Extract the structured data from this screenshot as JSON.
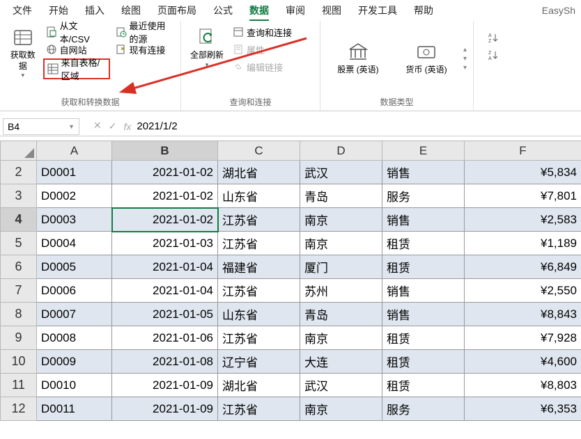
{
  "menu": {
    "items": [
      "文件",
      "开始",
      "插入",
      "绘图",
      "页面布局",
      "公式",
      "数据",
      "审阅",
      "视图",
      "开发工具",
      "帮助"
    ],
    "active_index": 6,
    "right": "EasySh"
  },
  "ribbon": {
    "group1": {
      "label": "获取和转换数据",
      "get_data": "获取数\n据",
      "from_csv": "从文本/CSV",
      "from_web": "自网站",
      "from_table": "来自表格/区域",
      "recent": "最近使用的源",
      "existing": "现有连接"
    },
    "group2": {
      "label": "查询和连接",
      "refresh_all": "全部刷新",
      "queries": "查询和连接",
      "properties": "属性",
      "edit_links": "编辑链接"
    },
    "group3": {
      "label": "数据类型",
      "stocks": "股票 (英语)",
      "currency": "货币 (英语)"
    }
  },
  "formula_bar": {
    "name_box": "B4",
    "formula": "2021/1/2"
  },
  "columns": [
    "A",
    "B",
    "C",
    "D",
    "E",
    "F"
  ],
  "active_row_index": 2,
  "active_col_index": 1,
  "rows": [
    {
      "n": 2,
      "band": true,
      "A": "D0001",
      "B": "2021-01-02",
      "C": "湖北省",
      "D": "武汉",
      "E": "销售",
      "F": "¥5,834"
    },
    {
      "n": 3,
      "band": false,
      "A": "D0002",
      "B": "2021-01-02",
      "C": "山东省",
      "D": "青岛",
      "E": "服务",
      "F": "¥7,801"
    },
    {
      "n": 4,
      "band": true,
      "A": "D0003",
      "B": "2021-01-02",
      "C": "江苏省",
      "D": "南京",
      "E": "销售",
      "F": "¥2,583"
    },
    {
      "n": 5,
      "band": false,
      "A": "D0004",
      "B": "2021-01-03",
      "C": "江苏省",
      "D": "南京",
      "E": "租赁",
      "F": "¥1,189"
    },
    {
      "n": 6,
      "band": true,
      "A": "D0005",
      "B": "2021-01-04",
      "C": "福建省",
      "D": "厦门",
      "E": "租赁",
      "F": "¥6,849"
    },
    {
      "n": 7,
      "band": false,
      "A": "D0006",
      "B": "2021-01-04",
      "C": "江苏省",
      "D": "苏州",
      "E": "销售",
      "F": "¥2,550"
    },
    {
      "n": 8,
      "band": true,
      "A": "D0007",
      "B": "2021-01-05",
      "C": "山东省",
      "D": "青岛",
      "E": "销售",
      "F": "¥8,843"
    },
    {
      "n": 9,
      "band": false,
      "A": "D0008",
      "B": "2021-01-06",
      "C": "江苏省",
      "D": "南京",
      "E": "租赁",
      "F": "¥7,928"
    },
    {
      "n": 10,
      "band": true,
      "A": "D0009",
      "B": "2021-01-08",
      "C": "辽宁省",
      "D": "大连",
      "E": "租赁",
      "F": "¥4,600"
    },
    {
      "n": 11,
      "band": false,
      "A": "D0010",
      "B": "2021-01-09",
      "C": "湖北省",
      "D": "武汉",
      "E": "租赁",
      "F": "¥8,803"
    },
    {
      "n": 12,
      "band": true,
      "A": "D0011",
      "B": "2021-01-09",
      "C": "江苏省",
      "D": "南京",
      "E": "服务",
      "F": "¥6,353"
    }
  ]
}
